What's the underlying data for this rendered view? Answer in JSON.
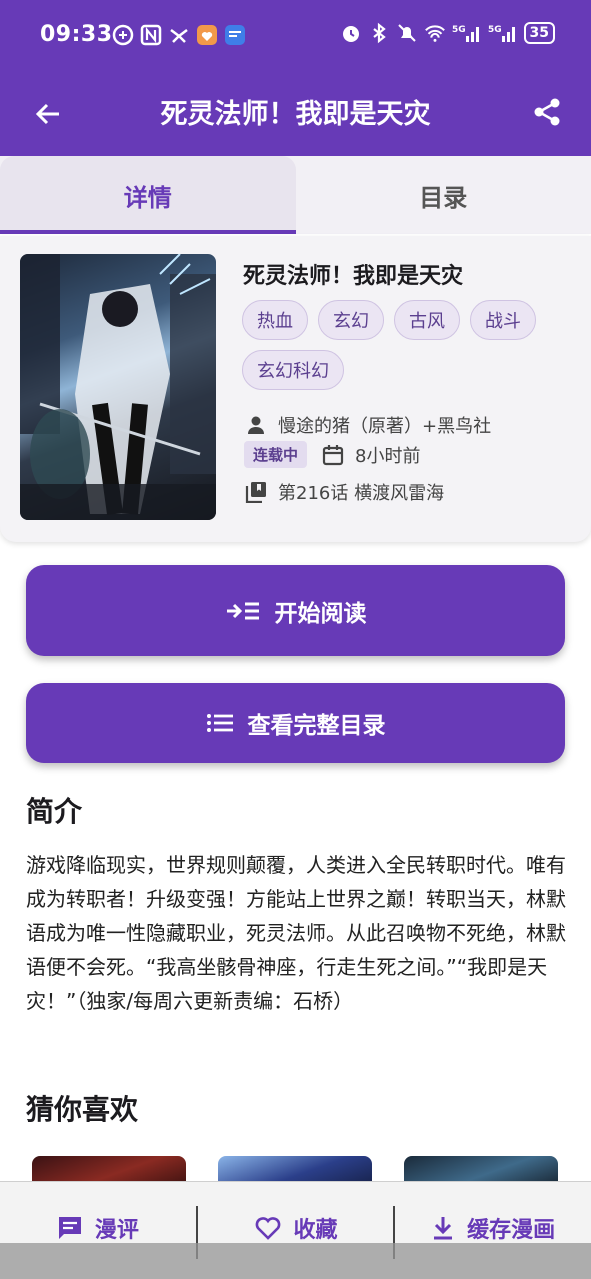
{
  "status_bar": {
    "time": "09:33",
    "battery": "35",
    "network": "5G"
  },
  "app_bar": {
    "title": "死灵法师！我即是天灾"
  },
  "tabs": [
    {
      "label": "详情"
    },
    {
      "label": "目录"
    }
  ],
  "book": {
    "title": "死灵法师！我即是天灾",
    "tags": [
      "热血",
      "玄幻",
      "古风",
      "战斗",
      "玄幻科幻"
    ],
    "author": "慢途的猪（原著）+黑鸟社",
    "status": "连载中",
    "updated": "8小时前",
    "latest_chapter": "第216话 横渡风雷海"
  },
  "actions": {
    "start_reading": "开始阅读",
    "view_catalog": "查看完整目录"
  },
  "intro": {
    "heading": "简介",
    "text": "游戏降临现实，世界规则颠覆，人类进入全民转职时代。唯有成为转职者！升级变强！方能站上世界之巅！转职当天，林默语成为唯一性隐藏职业，死灵法师。从此召唤物不死绝，林默语便不会死。“我高坐骸骨神座，行走生死之间。”“我即是天灾！”（独家/每周六更新责编：石桥）"
  },
  "recommend": {
    "heading": "猜你喜欢"
  },
  "bottom_bar": {
    "comments": "漫评",
    "favorite": "收藏",
    "download": "缓存漫画"
  },
  "colors": {
    "primary": "#673ab7",
    "tag_bg": "#ebe5f3",
    "tag_text": "#5b3f8f"
  }
}
